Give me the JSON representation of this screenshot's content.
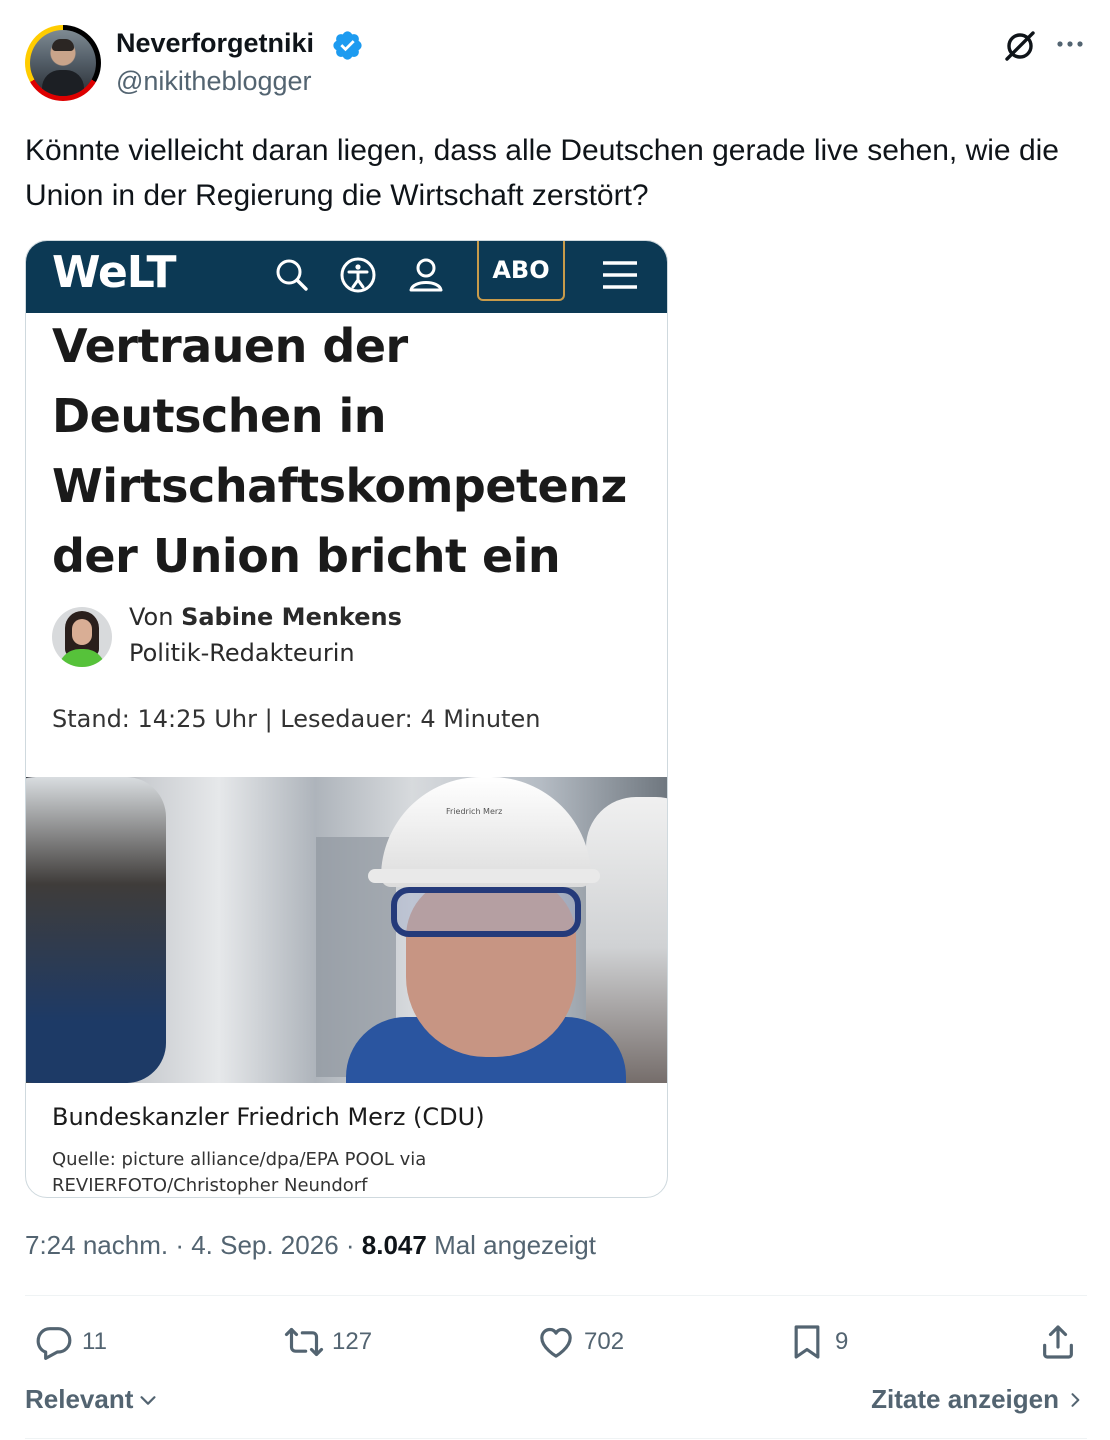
{
  "author": {
    "display_name": "Neverforgetniki",
    "handle": "@nikitheblogger",
    "verified": true
  },
  "tweet": {
    "text": "Könnte vielleicht daran liegen, dass alle Deutschen gerade live sehen, wie die Union in der Regierung die Wirtschaft zerstört?",
    "time": "7:24 nachm. · 4. Sep. 2026 · ",
    "views_count": "8.047",
    "views_label": " Mal angezeigt"
  },
  "article": {
    "brand": "WeLT",
    "abo_label": "ABO",
    "headline": "Vertrauen der Deutschen in Wirtschaftskompetenz der Union bricht ein",
    "author_prefix": "Von ",
    "author_name": "Sabine Menkens",
    "author_role": "Politik-Redakteurin",
    "meta": "Stand: 14:25 Uhr | Lesedauer: 4 Minuten",
    "helmet_text": "Friedrich Merz",
    "caption": "Bundeskanzler Friedrich Merz (CDU)",
    "source": "Quelle: picture alliance/dpa/EPA POOL via REVIERFOTO/Christopher Neundorf"
  },
  "actions": {
    "replies": "11",
    "reposts": "127",
    "likes": "702",
    "bookmarks": "9"
  },
  "footer": {
    "sort_label": "Relevant",
    "quotes_label": "Zitate anzeigen"
  },
  "colors": {
    "welt_navy": "#0c3954",
    "verified_blue": "#1d9bf0",
    "secondary_text": "#536471"
  },
  "icons": [
    "verified-badge-icon",
    "grok-icon",
    "more-icon",
    "search-icon",
    "accessibility-icon",
    "user-icon",
    "menu-icon",
    "reply-icon",
    "repost-icon",
    "like-icon",
    "bookmark-icon",
    "share-icon",
    "chevron-down-icon",
    "chevron-right-icon"
  ]
}
